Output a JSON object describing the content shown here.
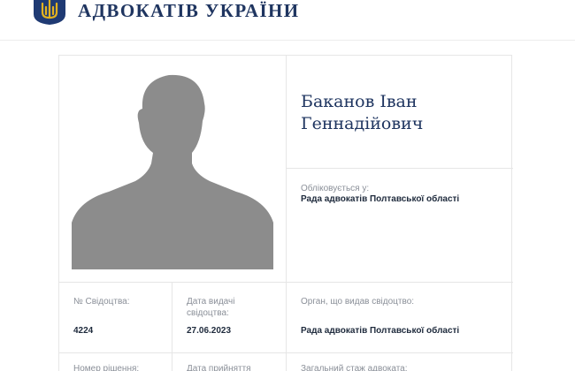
{
  "header": {
    "brand": "АДВОКАТІВ УКРАЇНИ",
    "logo_icon": "trident-shield-icon",
    "brand_color": "#1f3560",
    "emblem_color": "#1f3a73",
    "emblem_accent": "#e3b21f"
  },
  "profile": {
    "name": "Баканов Іван Геннадійович",
    "photo_icon": "person-silhouette-icon",
    "council_label": "Обліковується у:",
    "council_value": "Рада адвокатів Полтавської області"
  },
  "details": {
    "row1": [
      {
        "label": "№ Свідоцтва:",
        "value": "4224"
      },
      {
        "label": "Дата видачі свідоцтва:",
        "value": "27.06.2023"
      },
      {
        "label": "Орган, що видав свідоцтво:",
        "value": "Рада адвокатів Полтавської області"
      }
    ],
    "row2": [
      {
        "label": "Номер рішення:"
      },
      {
        "label": "Дата прийняття"
      },
      {
        "label": "Загальний стаж адвоката:"
      }
    ]
  }
}
